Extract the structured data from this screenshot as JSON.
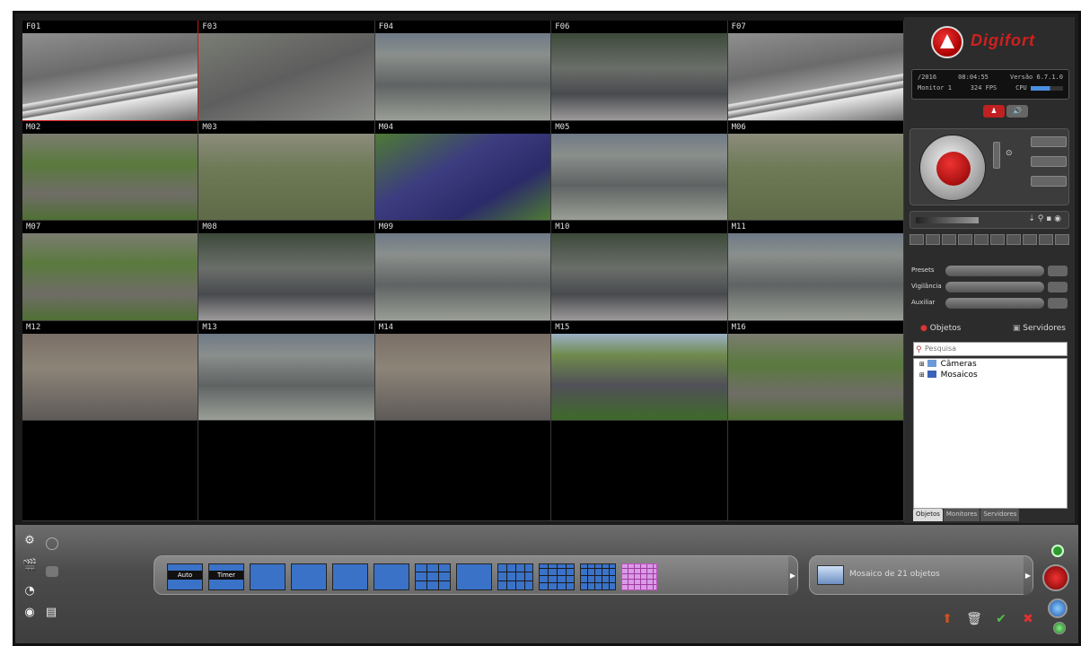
{
  "cameras": [
    {
      "id": "F01",
      "selected": true,
      "scene": "crosswalk"
    },
    {
      "id": "F03",
      "scene": "intersection"
    },
    {
      "id": "F04",
      "scene": "street"
    },
    {
      "id": "F06",
      "scene": "parked"
    },
    {
      "id": "F07",
      "scene": "crosswalk"
    },
    {
      "id": "M02",
      "scene": "park"
    },
    {
      "id": "M03",
      "scene": "grass"
    },
    {
      "id": "M04",
      "scene": "blue"
    },
    {
      "id": "M05",
      "scene": "street"
    },
    {
      "id": "M06",
      "scene": "grass"
    },
    {
      "id": "M07",
      "scene": "park"
    },
    {
      "id": "M08",
      "scene": "parked"
    },
    {
      "id": "M09",
      "scene": "street"
    },
    {
      "id": "M10",
      "scene": "parked"
    },
    {
      "id": "M11",
      "scene": "street"
    },
    {
      "id": "M12",
      "scene": "building"
    },
    {
      "id": "M13",
      "scene": "street"
    },
    {
      "id": "M14",
      "scene": "building"
    },
    {
      "id": "M15",
      "scene": "avenue"
    },
    {
      "id": "M16",
      "scene": "park"
    },
    {
      "id": "",
      "scene": "empty"
    },
    {
      "id": "",
      "scene": "empty"
    },
    {
      "id": "",
      "scene": "empty"
    },
    {
      "id": "",
      "scene": "empty"
    },
    {
      "id": "",
      "scene": "empty"
    }
  ],
  "panel": {
    "logo_text": "Digifort",
    "status": {
      "date": "/2016",
      "time": "08:04:55",
      "version": "Versão 6.7.1.0",
      "monitor": "Monitor 1",
      "fps": "324 FPS",
      "cpu_label": "CPU"
    },
    "combos": [
      {
        "label": "Presets"
      },
      {
        "label": "Vigilância"
      },
      {
        "label": "Auxiliar"
      }
    ],
    "objects_label": "Objetos",
    "servers_label": "Servidores",
    "search_placeholder": "Pesquisa",
    "tree": [
      {
        "label": "Câmeras",
        "icon": "camera-folder-icon"
      },
      {
        "label": "Mosaicos",
        "icon": "mosaic-folder-icon"
      }
    ],
    "tabs": [
      "Objetos",
      "Monitores",
      "Servidores"
    ],
    "active_tab": "Objetos"
  },
  "bottom": {
    "mosaic_buttons": [
      {
        "label": "Auto"
      },
      {
        "label": "Timer"
      },
      {
        "label": ""
      },
      {
        "label": ""
      },
      {
        "label": ""
      },
      {
        "label": ""
      },
      {
        "label": ""
      },
      {
        "label": ""
      },
      {
        "label": ""
      },
      {
        "label": ""
      },
      {
        "label": ""
      },
      {
        "label": ""
      }
    ],
    "mosaic_info": "Mosaico de 21 objetos"
  },
  "colors": {
    "selected_camera_border": "#d01818",
    "accent_red": "#d02020",
    "mosaic_blue": "#3a72c8",
    "mosaic_selected": "#d99be6"
  }
}
